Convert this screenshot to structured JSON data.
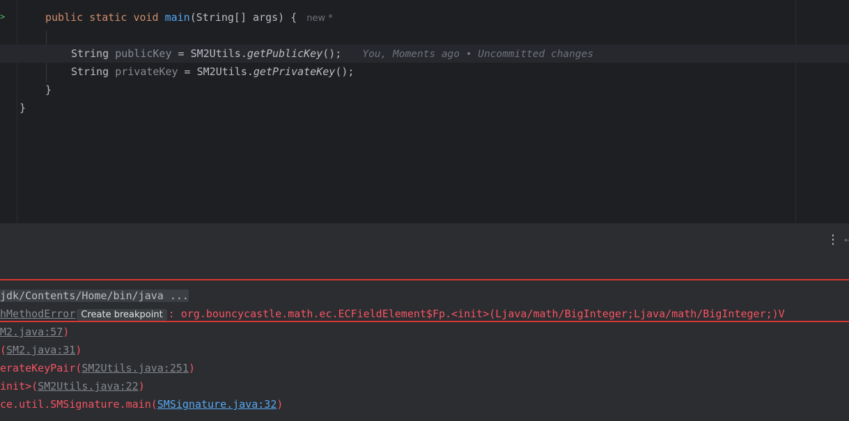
{
  "editor": {
    "main_signature": {
      "public": "public",
      "static": "static",
      "void": "void",
      "name": "main",
      "params": "(String[] args) {",
      "hint": "new *"
    },
    "line1": {
      "type": "String",
      "var": "publicKey",
      "eq": " = SM2Utils.",
      "method": "getPublicKey",
      "tail": "();",
      "blame": "You, Moments ago • Uncommitted changes"
    },
    "line2": {
      "type": "String",
      "var": "privateKey",
      "eq": " = SM2Utils.",
      "method": "getPrivateKey",
      "tail": "();"
    },
    "close_method": "}",
    "close_class": "}"
  },
  "console": {
    "cmd": "jdk/Contents/Home/bin/java ...",
    "error_prefix": "hMethodError",
    "breakpoint_label": "Create breakpoint",
    "error_message": ": org.bouncycastle.math.ec.ECFieldElement$Fp.<init>(Ljava/math/BigInteger;Ljava/math/BigInteger;)V",
    "frames": [
      {
        "pre": "",
        "link": "M2.java:57",
        "post": ")"
      },
      {
        "pre": "(",
        "link": "SM2.java:31",
        "post": ")"
      },
      {
        "pre": "erateKeyPair(",
        "link": "SM2Utils.java:251",
        "post": ")"
      },
      {
        "pre": "init>(",
        "link": "SM2Utils.java:22",
        "post": ")"
      },
      {
        "pre": "ce.util.SMSignature.main(",
        "link": "SMSignature.java:32",
        "post": ")"
      }
    ]
  },
  "colors": {
    "error": "#f75464",
    "keyword": "#cf8e6d",
    "function": "#56a8f5",
    "highlight_box": "#d93636"
  }
}
